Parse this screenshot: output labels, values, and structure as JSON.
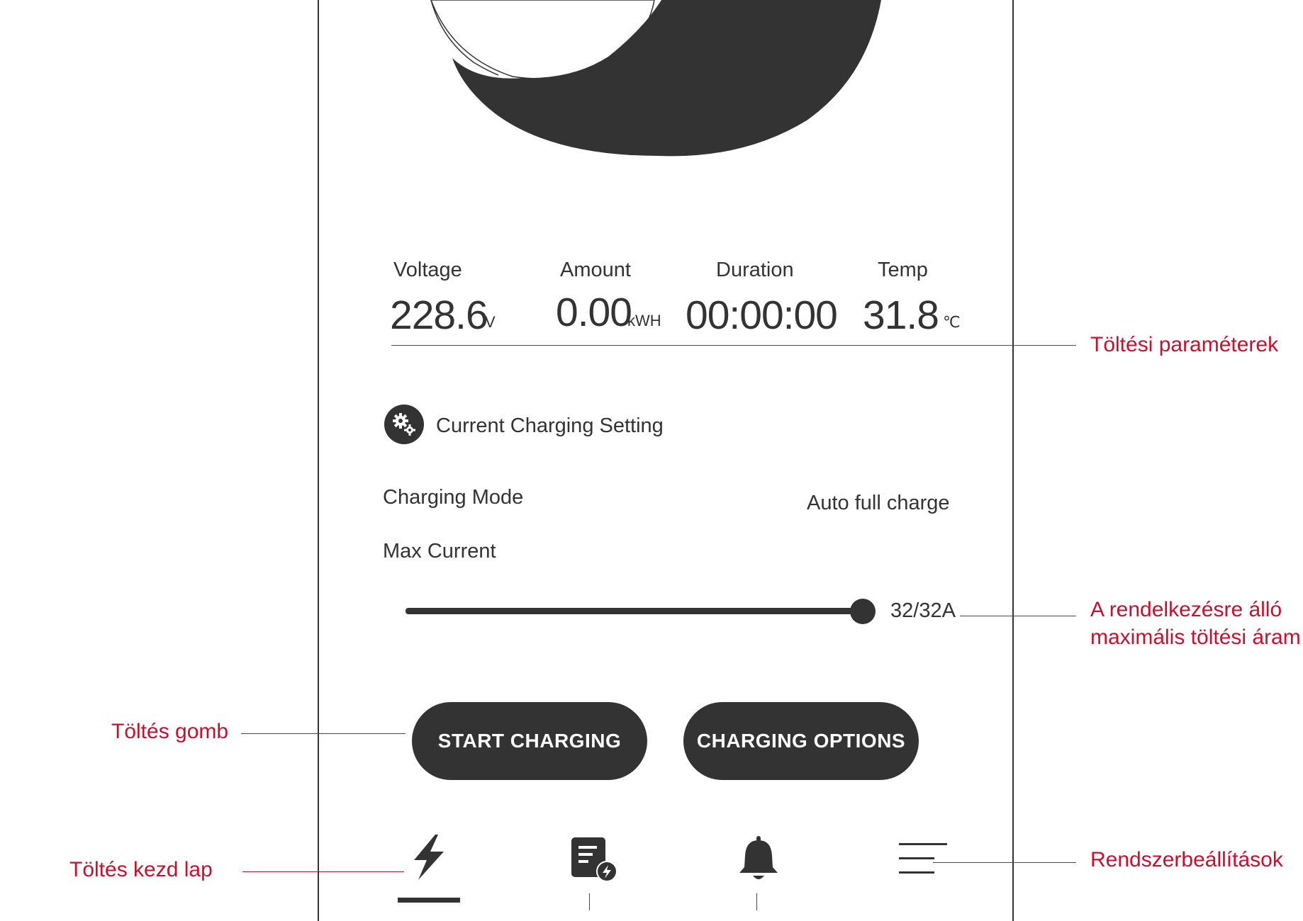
{
  "params": {
    "voltage": {
      "label": "Voltage",
      "value": "228.6",
      "unit": "V"
    },
    "amount": {
      "label": "Amount",
      "value": "0.00",
      "unit": "kWH"
    },
    "duration": {
      "label": "Duration",
      "value": "00:00:00"
    },
    "temp": {
      "label": "Temp",
      "value": "31.8",
      "unit": "℃"
    }
  },
  "settings": {
    "title": "Current Charging Setting",
    "mode_label": "Charging Mode",
    "mode_value": "Auto full charge",
    "max_current_label": "Max Current",
    "current_value": "32/32A",
    "current_fraction": 1.0
  },
  "buttons": {
    "start": "START CHARGING",
    "options": "CHARGING OPTIONS"
  },
  "annotations": {
    "params": "Töltési paraméterek",
    "max_current_line1": "A rendelkezésre álló",
    "max_current_line2": "maximális töltési áram",
    "button": "Töltés gomb",
    "home": "Töltés kezd  lap",
    "settings": "Rendszerbeállítások"
  },
  "nav": {
    "items": [
      "lightning-icon",
      "charging-record-icon",
      "bell-icon",
      "menu-icon"
    ],
    "active": 0
  },
  "colors": {
    "dark": "#333333",
    "annotation": "#c8102e",
    "background": "#ffffff"
  }
}
